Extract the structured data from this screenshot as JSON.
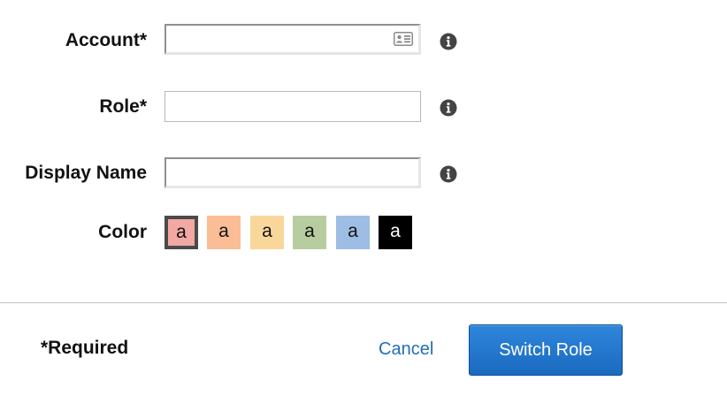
{
  "form": {
    "account": {
      "label": "Account*",
      "value": "",
      "icon": "contact-card-icon"
    },
    "role": {
      "label": "Role*",
      "value": ""
    },
    "display_name": {
      "label": "Display Name",
      "value": ""
    },
    "info_icon": "info-icon",
    "color": {
      "label": "Color",
      "selected_index": 0,
      "swatches": [
        {
          "text": "a",
          "bg": "#f2a8a3",
          "fg": "#111111"
        },
        {
          "text": "a",
          "bg": "#fbbd96",
          "fg": "#111111"
        },
        {
          "text": "a",
          "bg": "#f9d79b",
          "fg": "#111111"
        },
        {
          "text": "a",
          "bg": "#b7cda0",
          "fg": "#111111"
        },
        {
          "text": "a",
          "bg": "#9dbde4",
          "fg": "#111111"
        },
        {
          "text": "a",
          "bg": "#000000",
          "fg": "#ffffff"
        }
      ]
    }
  },
  "footer": {
    "required_note": "*Required",
    "cancel_label": "Cancel",
    "submit_label": "Switch Role"
  },
  "colors": {
    "link": "#1f6fb8",
    "primary_button": "#1a6ac0"
  }
}
